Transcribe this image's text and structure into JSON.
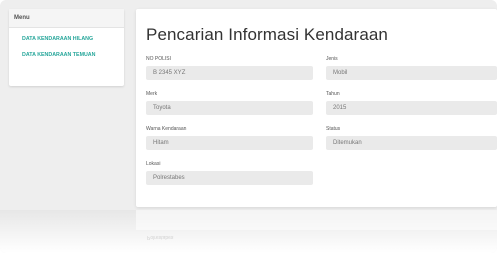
{
  "sidebar": {
    "header": "Menu",
    "items": [
      {
        "label": "DATA KENDARAAN HILANG"
      },
      {
        "label": "DATA KENDARAAN TEMUAN"
      }
    ]
  },
  "main": {
    "title": "Pencarian Informasi Kendaraan",
    "fields": {
      "no_polisi": {
        "label": "NO POLISI",
        "value": "B 2345 XYZ"
      },
      "jenis": {
        "label": "Jenis",
        "value": "Mobil"
      },
      "merk": {
        "label": "Merk",
        "value": "Toyota"
      },
      "tahun": {
        "label": "Tahun",
        "value": "2015"
      },
      "warna": {
        "label": "Warna Kendaraan",
        "value": "Hitam"
      },
      "status": {
        "label": "Status",
        "value": "Ditemukan"
      },
      "lokasi": {
        "label": "Lokasi",
        "value": "Polrestabes"
      }
    }
  },
  "colors": {
    "accent": "#26a69a",
    "field_bg": "#eaeaea",
    "page_bg": "#eeeeee"
  }
}
